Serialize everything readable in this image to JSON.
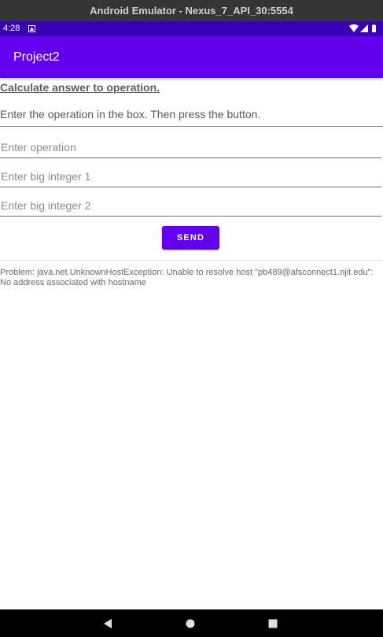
{
  "window": {
    "title": "Android Emulator - Nexus_7_API_30:5554"
  },
  "status_bar": {
    "time": "4:28",
    "icons": [
      "notification-icon",
      "wifi-icon",
      "signal-icon",
      "battery-icon"
    ]
  },
  "app_bar": {
    "title": "Project2",
    "color": "#6200ee"
  },
  "main": {
    "heading": "Calculate answer to operation.",
    "instruction": "Enter the operation in the box. Then press the button.",
    "fields": {
      "operation": {
        "placeholder": "Enter operation",
        "value": ""
      },
      "big_integer_1": {
        "placeholder": "Enter big integer 1",
        "value": ""
      },
      "big_integer_2": {
        "placeholder": "Enter big integer 2",
        "value": ""
      }
    },
    "send_label": "SEND",
    "result": "Problem: java.net.UnknownHostException: Unable to resolve host \"pb489@afsconnect1.njit.edu\":\nNo address associated with hostname"
  },
  "nav_bar": {
    "icons": [
      "back-icon",
      "home-icon",
      "recents-icon"
    ]
  },
  "colors": {
    "accent": "#6200ee",
    "status_bar": "#3700b3"
  }
}
